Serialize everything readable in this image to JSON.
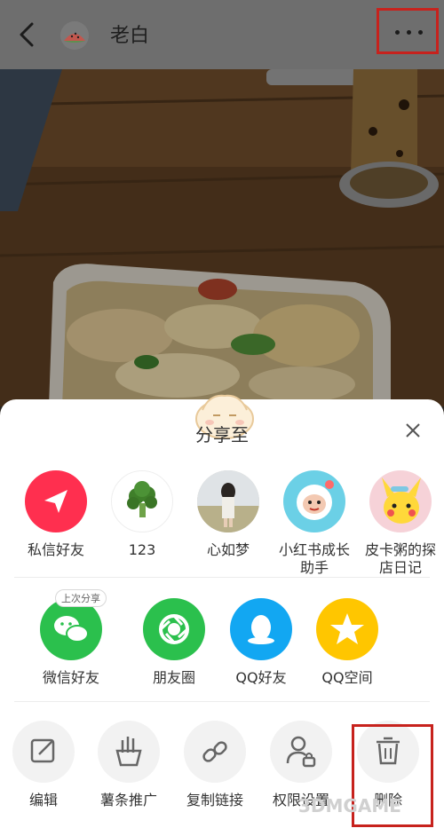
{
  "header": {
    "title": "老白",
    "more_label": "···"
  },
  "share_sheet": {
    "title": "分享至",
    "contacts": [
      {
        "label": "私信好友",
        "icon": "paper-plane-icon",
        "color": "#ff2f4f"
      },
      {
        "label": "123",
        "icon": "broccoli-icon"
      },
      {
        "label": "心如梦",
        "icon": "girl-photo-avatar"
      },
      {
        "label": "小红书成长\n助手",
        "icon": "astronaut-avatar"
      },
      {
        "label": "皮卡粥的探\n店日记",
        "icon": "pikachu-avatar"
      }
    ],
    "apps": [
      {
        "label": "微信好友",
        "icon": "wechat-icon",
        "color": "#2bc04d",
        "badge": "上次分享"
      },
      {
        "label": "朋友圈",
        "icon": "moments-icon",
        "color": "#2bc04d"
      },
      {
        "label": "QQ好友",
        "icon": "qq-icon",
        "color": "#12a7f2"
      },
      {
        "label": "QQ空间",
        "icon": "qzone-icon",
        "color": "#ffc600"
      }
    ],
    "actions": [
      {
        "label": "编辑",
        "icon": "edit-icon"
      },
      {
        "label": "薯条推广",
        "icon": "fries-icon"
      },
      {
        "label": "复制链接",
        "icon": "link-icon"
      },
      {
        "label": "权限设置",
        "icon": "user-lock-icon"
      },
      {
        "label": "删除",
        "icon": "trash-icon"
      }
    ]
  },
  "watermark": "3DMGAME"
}
